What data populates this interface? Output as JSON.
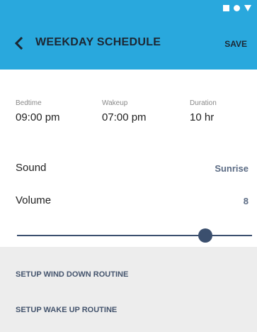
{
  "header": {
    "title": "WEEKDAY SCHEDULE",
    "save_label": "SAVE",
    "back_icon": "chevron-left-icon",
    "accent_color": "#29a8dd"
  },
  "status_bar": {
    "icons": [
      "square-icon",
      "circle-icon",
      "triangle-icon"
    ]
  },
  "schedule": {
    "bedtime": {
      "label": "Bedtime",
      "value": "09:00 pm"
    },
    "wakeup": {
      "label": "Wakeup",
      "value": "07:00 pm"
    },
    "duration": {
      "label": "Duration",
      "value": "10 hr"
    }
  },
  "sound": {
    "label": "Sound",
    "value": "Sunrise"
  },
  "volume": {
    "label": "Volume",
    "value": "8",
    "level_fraction": 0.8
  },
  "routines": {
    "wind_down": "SETUP WIND DOWN ROUTINE",
    "wake_up": "SETUP WAKE UP ROUTINE"
  }
}
